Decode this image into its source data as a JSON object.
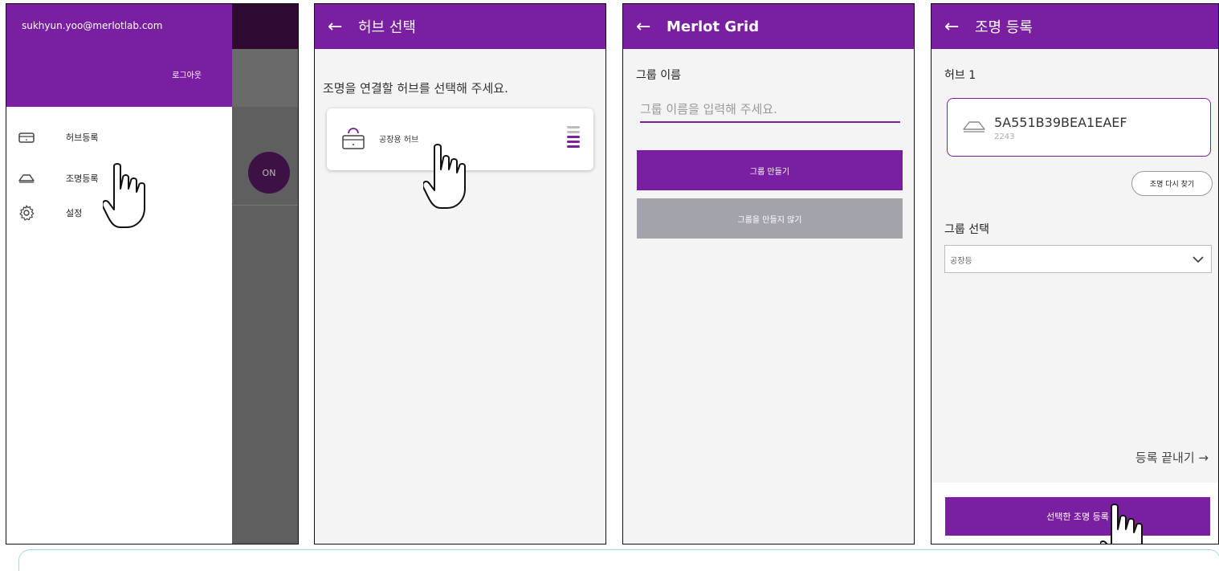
{
  "screen1": {
    "email": "sukhyun.yoo@merlotlab.com",
    "logout": "로그아웃",
    "menu": [
      {
        "label": "허브등록",
        "icon": "hub-icon"
      },
      {
        "label": "조명등록",
        "icon": "lamp-icon"
      },
      {
        "label": "설정",
        "icon": "gear-icon"
      }
    ],
    "on_label": "ON"
  },
  "screen2": {
    "title": "허브 선택",
    "prompt": "조명을 연결할 허브를 선택해 주세요.",
    "hub_name": "공장용 허브"
  },
  "screen3": {
    "title": "Merlot Grid",
    "group_label": "그룹 이름",
    "group_placeholder": "그룹 이름을 입력해 주세요.",
    "make_button": "그룹 만들기",
    "skip_button": "그룹을 만들지 않기"
  },
  "screen4": {
    "title": "조명 등록",
    "hub_label": "허브 1",
    "light_id": "5A551B39BEA1EAEF",
    "light_sub": "2243",
    "refind_button": "조명 다시 찾기",
    "group_select_label": "그룹 선택",
    "group_selected": "공장등",
    "finish_link": "등록 끝내기 →",
    "register_button": "선택한 조명 등록"
  },
  "colors": {
    "primary": "#7b1fa2",
    "overlay": "#5f5f5f",
    "disabled": "#a3a3ab"
  }
}
